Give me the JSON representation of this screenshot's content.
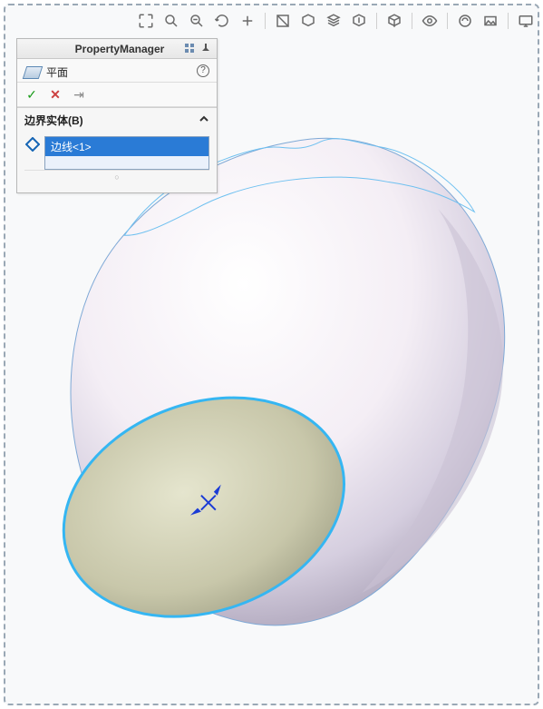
{
  "propertyManager": {
    "title": "PropertyManager",
    "featureName": "平面",
    "helpSymbol": "?",
    "sectionTitle": "边界实体(B)",
    "selectedItem": "边线<1>",
    "grip": "○"
  },
  "actions": {
    "ok": "✓",
    "cancel": "✕",
    "pin": "⇥"
  },
  "originMarker": "✱"
}
